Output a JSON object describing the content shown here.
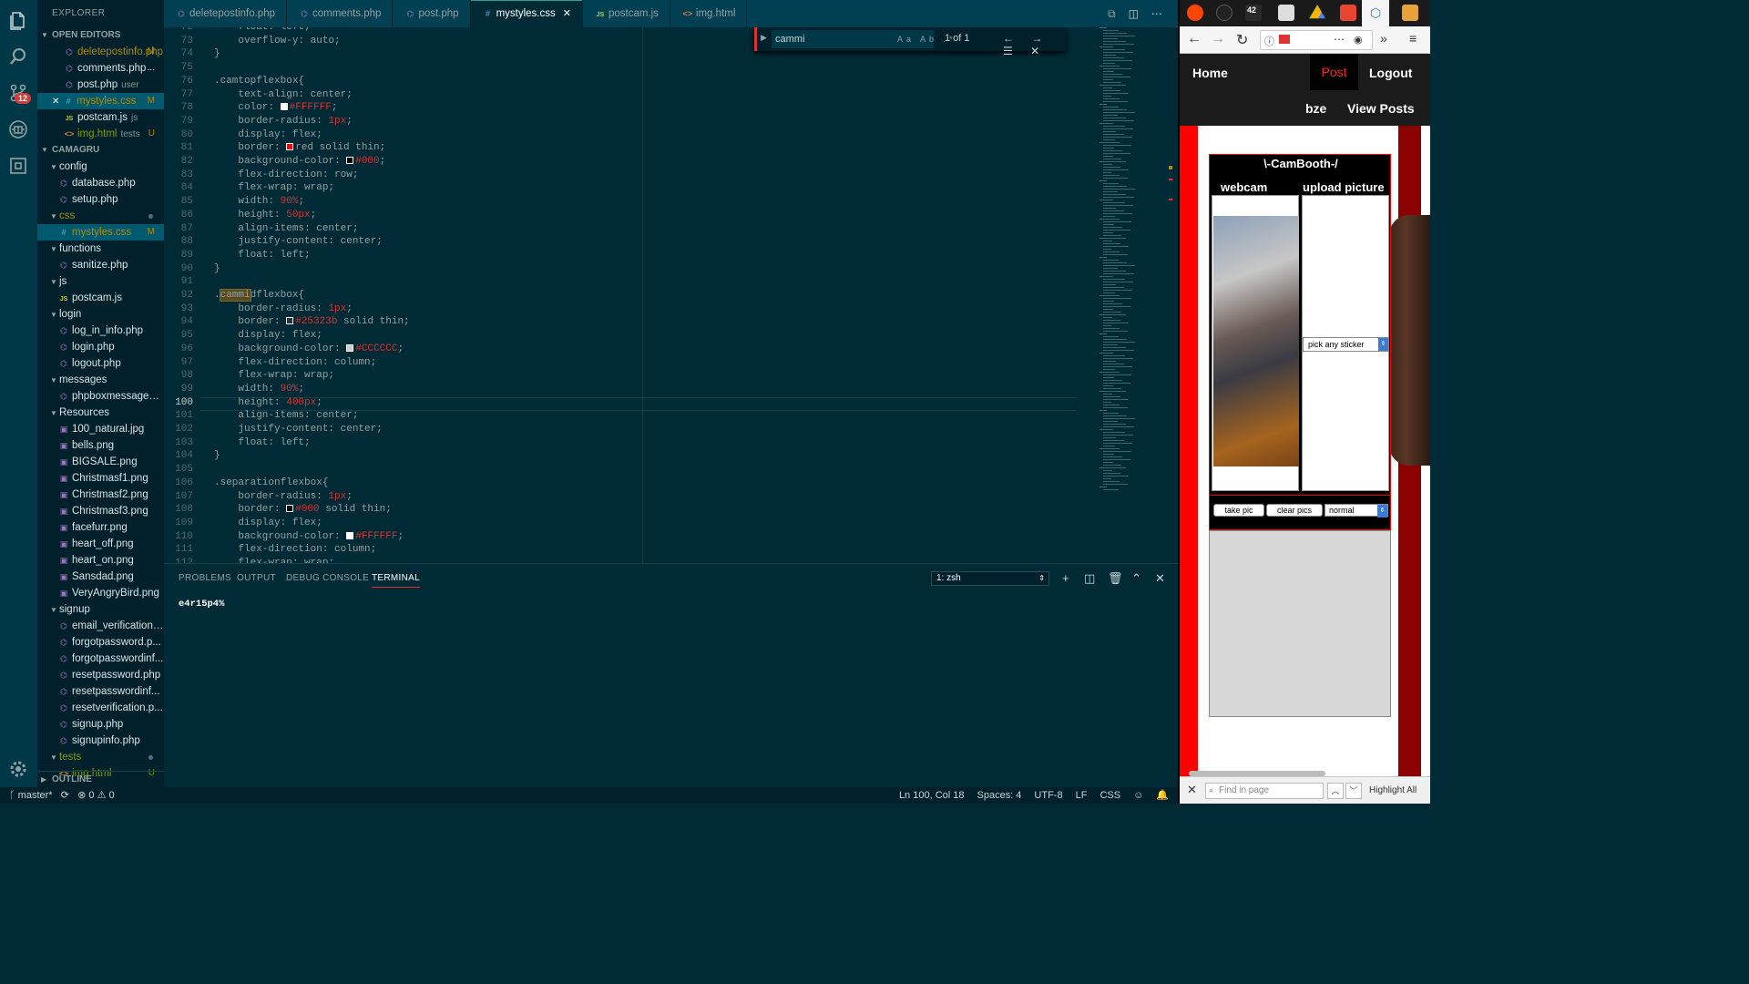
{
  "explorer": {
    "title": "EXPLORER",
    "open_editors_label": "OPEN EDITORS",
    "open_editors": [
      {
        "name": "deletepostinfo.php",
        "type": "php",
        "badge": "M"
      },
      {
        "name": "comments.php",
        "type": "php",
        "badge": "..."
      },
      {
        "name": "post.php",
        "type": "php",
        "sub": "user"
      },
      {
        "name": "mystyles.css",
        "type": "css",
        "badge": "M",
        "active": true
      },
      {
        "name": "postcam.js",
        "type": "js",
        "sub": "js"
      },
      {
        "name": "img.html",
        "type": "html",
        "sub": "tests",
        "badge": "U"
      }
    ],
    "project_label": "CAMAGRU",
    "tree": [
      {
        "name": "config",
        "folder": true,
        "depth": 0
      },
      {
        "name": "database.php",
        "type": "php",
        "depth": 1
      },
      {
        "name": "setup.php",
        "type": "php",
        "depth": 1
      },
      {
        "name": "css",
        "folder": true,
        "depth": 0,
        "modified": true
      },
      {
        "name": "mystyles.css",
        "type": "css",
        "depth": 1,
        "badge": "M",
        "active": true
      },
      {
        "name": "functions",
        "folder": true,
        "depth": 0
      },
      {
        "name": "sanitize.php",
        "type": "php",
        "depth": 1
      },
      {
        "name": "js",
        "folder": true,
        "depth": 0
      },
      {
        "name": "postcam.js",
        "type": "js",
        "depth": 1
      },
      {
        "name": "login",
        "folder": true,
        "depth": 0
      },
      {
        "name": "log_in_info.php",
        "type": "php",
        "depth": 1
      },
      {
        "name": "login.php",
        "type": "php",
        "depth": 1
      },
      {
        "name": "logout.php",
        "type": "php",
        "depth": 1
      },
      {
        "name": "messages",
        "folder": true,
        "depth": 0
      },
      {
        "name": "phpboxmessages....",
        "type": "php",
        "depth": 1
      },
      {
        "name": "Resources",
        "folder": true,
        "depth": 0
      },
      {
        "name": "100_natural.jpg",
        "type": "img",
        "depth": 1
      },
      {
        "name": "bells.png",
        "type": "img",
        "depth": 1
      },
      {
        "name": "BIGSALE.png",
        "type": "img",
        "depth": 1
      },
      {
        "name": "Christmasf1.png",
        "type": "img",
        "depth": 1
      },
      {
        "name": "Christmasf2.png",
        "type": "img",
        "depth": 1
      },
      {
        "name": "Christmasf3.png",
        "type": "img",
        "depth": 1
      },
      {
        "name": "facefurr.png",
        "type": "img",
        "depth": 1
      },
      {
        "name": "heart_off.png",
        "type": "img",
        "depth": 1
      },
      {
        "name": "heart_on.png",
        "type": "img",
        "depth": 1
      },
      {
        "name": "Sansdad.png",
        "type": "img",
        "depth": 1
      },
      {
        "name": "VeryAngryBird.png",
        "type": "img",
        "depth": 1
      },
      {
        "name": "signup",
        "folder": true,
        "depth": 0
      },
      {
        "name": "email_verification....",
        "type": "php",
        "depth": 1
      },
      {
        "name": "forgotpassword.p...",
        "type": "php",
        "depth": 1
      },
      {
        "name": "forgotpasswordinf...",
        "type": "php",
        "depth": 1
      },
      {
        "name": "resetpassword.php",
        "type": "php",
        "depth": 1
      },
      {
        "name": "resetpasswordinf...",
        "type": "php",
        "depth": 1
      },
      {
        "name": "resetverification.p...",
        "type": "php",
        "depth": 1
      },
      {
        "name": "signup.php",
        "type": "php",
        "depth": 1
      },
      {
        "name": "signupinfo.php",
        "type": "php",
        "depth": 1
      },
      {
        "name": "tests",
        "folder": true,
        "depth": 0,
        "untracked": true
      },
      {
        "name": "img.html",
        "type": "html",
        "depth": 1,
        "badge": "U",
        "untracked": true
      }
    ],
    "outline_label": "OUTLINE"
  },
  "activity_badge": "12",
  "tabs": [
    {
      "name": "deletepostinfo.php",
      "type": "php"
    },
    {
      "name": "comments.php",
      "type": "php"
    },
    {
      "name": "post.php",
      "type": "php"
    },
    {
      "name": "mystyles.css",
      "type": "css",
      "active": true
    },
    {
      "name": "postcam.js",
      "type": "js"
    },
    {
      "name": "img.html",
      "type": "html"
    }
  ],
  "find_widget": {
    "query": "cammi",
    "options": "Aa Ab .*",
    "count": "1 of 1"
  },
  "code_lines": [
    {
      "n": "72",
      "segs": [
        [
          "    float: left;",
          "p"
        ]
      ]
    },
    {
      "n": "73",
      "segs": [
        [
          "    overflow-y: auto;",
          "p"
        ]
      ]
    },
    {
      "n": "74",
      "segs": [
        [
          "}",
          "p"
        ]
      ]
    },
    {
      "n": "75",
      "segs": []
    },
    {
      "n": "76",
      "segs": [
        [
          ".camtopflexbox{",
          "s"
        ]
      ]
    },
    {
      "n": "77",
      "segs": [
        [
          "    text-align: center;",
          "p"
        ]
      ]
    },
    {
      "n": "78",
      "segs": [
        [
          "    color: ",
          "p"
        ],
        [
          "#FFFFFF",
          "swatch"
        ],
        [
          "#FFFFFF",
          "h"
        ],
        [
          ";",
          "p"
        ]
      ]
    },
    {
      "n": "79",
      "segs": [
        [
          "    border-radius: ",
          "p"
        ],
        [
          "1px",
          "h"
        ],
        [
          ";",
          "p"
        ]
      ]
    },
    {
      "n": "80",
      "segs": [
        [
          "    display: flex;",
          "p"
        ]
      ]
    },
    {
      "n": "81",
      "segs": [
        [
          "    border: ",
          "p"
        ],
        [
          "#ff0000",
          "swatch"
        ],
        [
          "red solid thin;",
          "p"
        ]
      ]
    },
    {
      "n": "82",
      "segs": [
        [
          "    background-color: ",
          "p"
        ],
        [
          "#000000",
          "swatch"
        ],
        [
          "#000",
          "h"
        ],
        [
          ";",
          "p"
        ]
      ]
    },
    {
      "n": "83",
      "segs": [
        [
          "    flex-direction: row;",
          "p"
        ]
      ]
    },
    {
      "n": "84",
      "segs": [
        [
          "    flex-wrap: wrap;",
          "p"
        ]
      ]
    },
    {
      "n": "85",
      "segs": [
        [
          "    width: ",
          "p"
        ],
        [
          "90%",
          "h"
        ],
        [
          ";",
          "p"
        ]
      ]
    },
    {
      "n": "86",
      "segs": [
        [
          "    height: ",
          "p"
        ],
        [
          "50px",
          "h"
        ],
        [
          ";",
          "p"
        ]
      ]
    },
    {
      "n": "87",
      "segs": [
        [
          "    align-items: center;",
          "p"
        ]
      ]
    },
    {
      "n": "88",
      "segs": [
        [
          "    justify-content: center;",
          "p"
        ]
      ]
    },
    {
      "n": "89",
      "segs": [
        [
          "    float: left;",
          "p"
        ]
      ]
    },
    {
      "n": "90",
      "segs": [
        [
          "}",
          "p"
        ]
      ]
    },
    {
      "n": "91",
      "segs": []
    },
    {
      "n": "92",
      "segs": [
        [
          ".",
          "s"
        ],
        [
          "cammi",
          "m"
        ],
        [
          "dflexbox{",
          "s"
        ]
      ]
    },
    {
      "n": "93",
      "segs": [
        [
          "    border-radius: ",
          "p"
        ],
        [
          "1px",
          "h"
        ],
        [
          ";",
          "p"
        ]
      ]
    },
    {
      "n": "94",
      "segs": [
        [
          "    border: ",
          "p"
        ],
        [
          "#25323b",
          "swatch"
        ],
        [
          "#25323b",
          "h"
        ],
        [
          " solid thin;",
          "p"
        ]
      ]
    },
    {
      "n": "95",
      "segs": [
        [
          "    display: flex;",
          "p"
        ]
      ]
    },
    {
      "n": "96",
      "segs": [
        [
          "    background-color: ",
          "p"
        ],
        [
          "#CCCCCC",
          "swatch"
        ],
        [
          "#CCCCCC",
          "h"
        ],
        [
          ";",
          "p"
        ]
      ]
    },
    {
      "n": "97",
      "segs": [
        [
          "    flex-direction: column;",
          "p"
        ]
      ]
    },
    {
      "n": "98",
      "segs": [
        [
          "    flex-wrap: wrap;",
          "p"
        ]
      ]
    },
    {
      "n": "99",
      "segs": [
        [
          "    width: ",
          "p"
        ],
        [
          "90%",
          "h"
        ],
        [
          ";",
          "p"
        ]
      ]
    },
    {
      "n": "100",
      "segs": [
        [
          "    height: ",
          "p"
        ],
        [
          "400px",
          "h"
        ],
        [
          ";",
          "p"
        ]
      ],
      "current": true
    },
    {
      "n": "101",
      "segs": [
        [
          "    align-items: center;",
          "p"
        ]
      ]
    },
    {
      "n": "102",
      "segs": [
        [
          "    justify-content: center;",
          "p"
        ]
      ]
    },
    {
      "n": "103",
      "segs": [
        [
          "    float: left;",
          "p"
        ]
      ]
    },
    {
      "n": "104",
      "segs": [
        [
          "}",
          "p"
        ]
      ]
    },
    {
      "n": "105",
      "segs": []
    },
    {
      "n": "106",
      "segs": [
        [
          ".separationflexbox{",
          "s"
        ]
      ]
    },
    {
      "n": "107",
      "segs": [
        [
          "    border-radius: ",
          "p"
        ],
        [
          "1px",
          "h"
        ],
        [
          ";",
          "p"
        ]
      ]
    },
    {
      "n": "108",
      "segs": [
        [
          "    border: ",
          "p"
        ],
        [
          "#000000",
          "swatch"
        ],
        [
          "#000",
          "h"
        ],
        [
          " solid thin;",
          "p"
        ]
      ]
    },
    {
      "n": "109",
      "segs": [
        [
          "    display: flex;",
          "p"
        ]
      ]
    },
    {
      "n": "110",
      "segs": [
        [
          "    background-color: ",
          "p"
        ],
        [
          "#FFFFFF",
          "swatch"
        ],
        [
          "#FFFFFF",
          "h"
        ],
        [
          ";",
          "p"
        ]
      ]
    },
    {
      "n": "111",
      "segs": [
        [
          "    flex-direction: column;",
          "p"
        ]
      ]
    },
    {
      "n": "112",
      "segs": [
        [
          "    flex-wrap: wrap;",
          "p"
        ]
      ]
    }
  ],
  "panel": {
    "tabs": [
      "PROBLEMS",
      "OUTPUT",
      "DEBUG CONSOLE",
      "TERMINAL"
    ],
    "active_tab": "TERMINAL",
    "terminal_select": "1: zsh",
    "terminal_text": "e4r15p4%"
  },
  "status": {
    "branch": "master*",
    "errors": "0",
    "warnings": "0",
    "position": "Ln 100, Col 18",
    "spaces": "Spaces: 4",
    "encoding": "UTF-8",
    "eol": "LF",
    "language": "CSS"
  },
  "browser": {
    "nav": {
      "home": "Home",
      "post": "Post",
      "logout": "Logout",
      "user": "bze",
      "view_posts": "View Posts"
    },
    "booth_title": "\\-CamBooth-/",
    "webcam_label": "webcam",
    "upload_label": "upload picture",
    "sticker_select": "pick any sticker",
    "take_pic": "take pic",
    "clear_pics": "clear pics",
    "mode_select": "normal",
    "find_placeholder": "Find in page",
    "highlight_all": "Highlight All"
  },
  "colors": {
    "accent_red": "#dc322f",
    "editor_bg": "#002b36",
    "sidebar_bg": "#00212b",
    "modified": "#b58900",
    "untracked": "#859900"
  }
}
